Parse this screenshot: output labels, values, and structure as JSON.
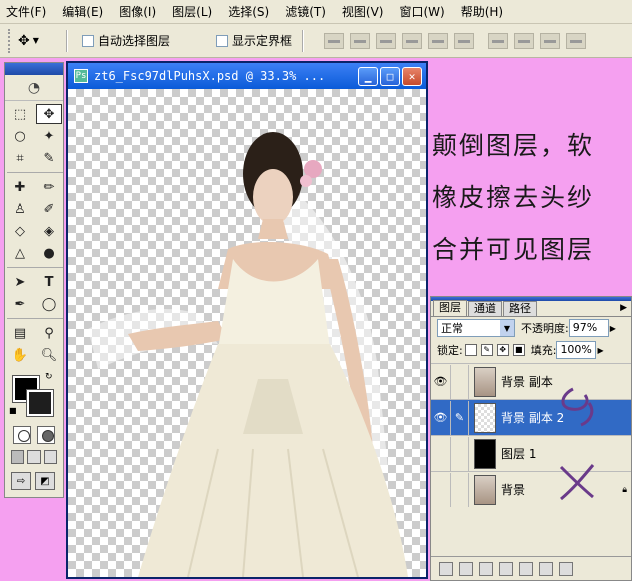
{
  "menubar": {
    "items": [
      "文件(F)",
      "编辑(E)",
      "图像(I)",
      "图层(L)",
      "选择(S)",
      "滤镜(T)",
      "视图(V)",
      "窗口(W)",
      "帮助(H)"
    ]
  },
  "options": {
    "auto_select_label": "自动选择图层",
    "auto_select_checked": false,
    "show_bounds_label": "显示定界框",
    "show_bounds_checked": false
  },
  "document": {
    "title": "zt6_Fsc97dlPuhsX.psd @ 33.3% ..."
  },
  "annotation": {
    "lines": [
      "颠倒图层，软",
      "橡皮擦去头纱",
      "合并可见图层"
    ]
  },
  "layers_panel": {
    "tabs": [
      "图层",
      "通道",
      "路径"
    ],
    "active_tab": "图层",
    "blend_mode": "正常",
    "opacity_label": "不透明度:",
    "opacity_value": "97%",
    "lock_label": "锁定:",
    "fill_label": "填充:",
    "fill_value": "100%",
    "layers": [
      {
        "name": "背景 副本",
        "visible": true,
        "selected": false,
        "thumb": "photo",
        "locked": false
      },
      {
        "name": "背景 副本 2",
        "visible": true,
        "selected": true,
        "thumb": "checker",
        "locked": false
      },
      {
        "name": "图层 1",
        "visible": false,
        "selected": false,
        "thumb": "black",
        "locked": false
      },
      {
        "name": "背景",
        "visible": false,
        "selected": false,
        "thumb": "photo",
        "locked": true
      }
    ]
  },
  "colors": {
    "foreground": "#000000",
    "background": "#1e1e1e",
    "page_background": "#f5a0f0",
    "selection": "#316ac5"
  }
}
